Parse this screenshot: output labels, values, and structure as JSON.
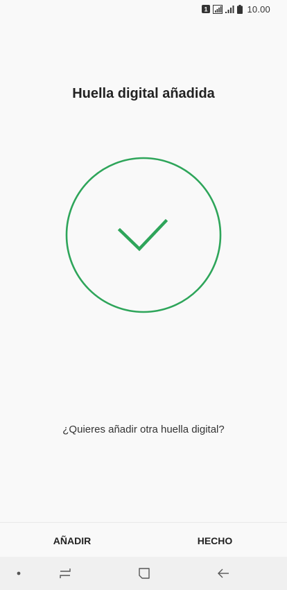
{
  "status_bar": {
    "sim_slot": "1",
    "time": "10.00",
    "icons": [
      "sim-icon",
      "signal-icon",
      "signal-bars-icon",
      "battery-icon"
    ]
  },
  "screen": {
    "title": "Huella digital añadida",
    "success_icon": "check-circle-icon",
    "question": "¿Quieres añadir otra huella digital?"
  },
  "actions": {
    "add_label": "AÑADIR",
    "done_label": "HECHO"
  },
  "nav_bar": {
    "icons": [
      "nav-dot-icon",
      "recent-apps-icon",
      "home-icon",
      "back-icon"
    ]
  },
  "colors": {
    "accent": "#2ea55a",
    "background": "#f9f9f9",
    "nav_background": "#f0f0f0"
  }
}
